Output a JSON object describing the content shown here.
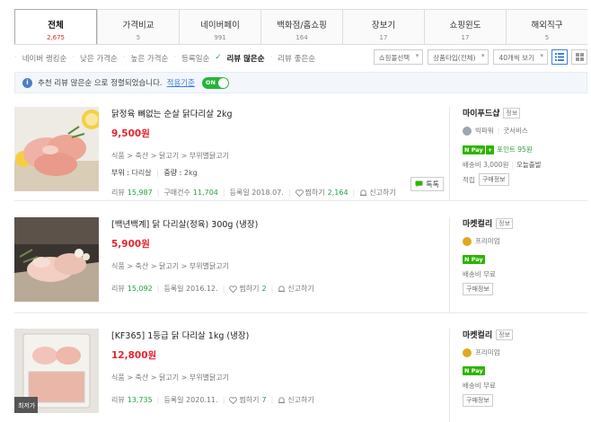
{
  "tabs": [
    {
      "label": "전체",
      "count": "2,675"
    },
    {
      "label": "가격비교",
      "count": "5"
    },
    {
      "label": "네이버페이",
      "count": "991"
    },
    {
      "label": "백화점/홈쇼핑",
      "count": "164"
    },
    {
      "label": "장보기",
      "count": "17"
    },
    {
      "label": "쇼핑윈도",
      "count": "17"
    },
    {
      "label": "해외직구",
      "count": "5"
    }
  ],
  "sort_options": [
    "네이버 랭킹순",
    "낮은 가격순",
    "높은 가격순",
    "등록일순",
    "리뷰 많은순",
    "리뷰 좋은순"
  ],
  "active_sort": "리뷰 많은순",
  "filters": {
    "shop_select": "쇼핑몰선택",
    "product_type": "상품타입(전체)",
    "page_size": "40개씩 보기"
  },
  "notice": {
    "text": "추천 리뷰 많은순 으로 정렬되었습니다.",
    "link": "적용기준",
    "toggle": "ON"
  },
  "colors": {
    "accent_red": "#e4252d",
    "npay_green": "#2db400",
    "link_blue": "#3d7ed8"
  },
  "products": [
    {
      "title": "닭정육 뼈없는 순살 닭다리살 2kg",
      "price": "9,500원",
      "category": "식품 > 축산 > 닭고기 > 부위별닭고기",
      "spec_label1": "부위 :",
      "spec_val1": "다리살",
      "spec_label2": "중량 :",
      "spec_val2": "2kg",
      "review_label": "리뷰",
      "review_count": "15,987",
      "purchase_label": "구매건수",
      "purchase_count": "11,704",
      "date": "등록일 2018.07.",
      "wish_label": "찜하기",
      "wish_count": "2,164",
      "report": "신고하기",
      "talk": "톡톡",
      "mall": "마이푸드샵",
      "mall_badge": "정보",
      "grade": "빅파워",
      "grade2": "굿서비스",
      "npay_point": "포인트 95원",
      "shipping": "배송비 3,000원",
      "shipping_extra": "오늘출발",
      "extra_label": "적립",
      "extra_button": "구매정보"
    },
    {
      "title": "[백년백계] 닭 다리살(정육) 300g (냉장)",
      "price": "5,900원",
      "category": "식품 > 축산 > 닭고기 > 부위별닭고기",
      "review_label": "리뷰",
      "review_count": "15,092",
      "date": "등록일 2016.12.",
      "wish_label": "찜하기",
      "wish_count": "2",
      "report": "신고하기",
      "mall": "마켓컬리",
      "mall_badge": "정보",
      "grade": "프리미엄",
      "shipping": "배송비 무료",
      "extra_button": "구매정보"
    },
    {
      "title": "[KF365] 1등급 닭 다리살 1kg (냉장)",
      "price": "12,800원",
      "category": "식품 > 축산 > 닭고기 > 부위별닭고기",
      "review_label": "리뷰",
      "review_count": "13,735",
      "date": "등록일 2020.11.",
      "wish_label": "찜하기",
      "wish_count": "7",
      "report": "신고하기",
      "mall": "마켓컬리",
      "mall_badge": "정보",
      "grade": "프리미엄",
      "shipping": "배송비 무료",
      "extra_button": "구매정보",
      "thumb_badge": "최저가"
    }
  ]
}
